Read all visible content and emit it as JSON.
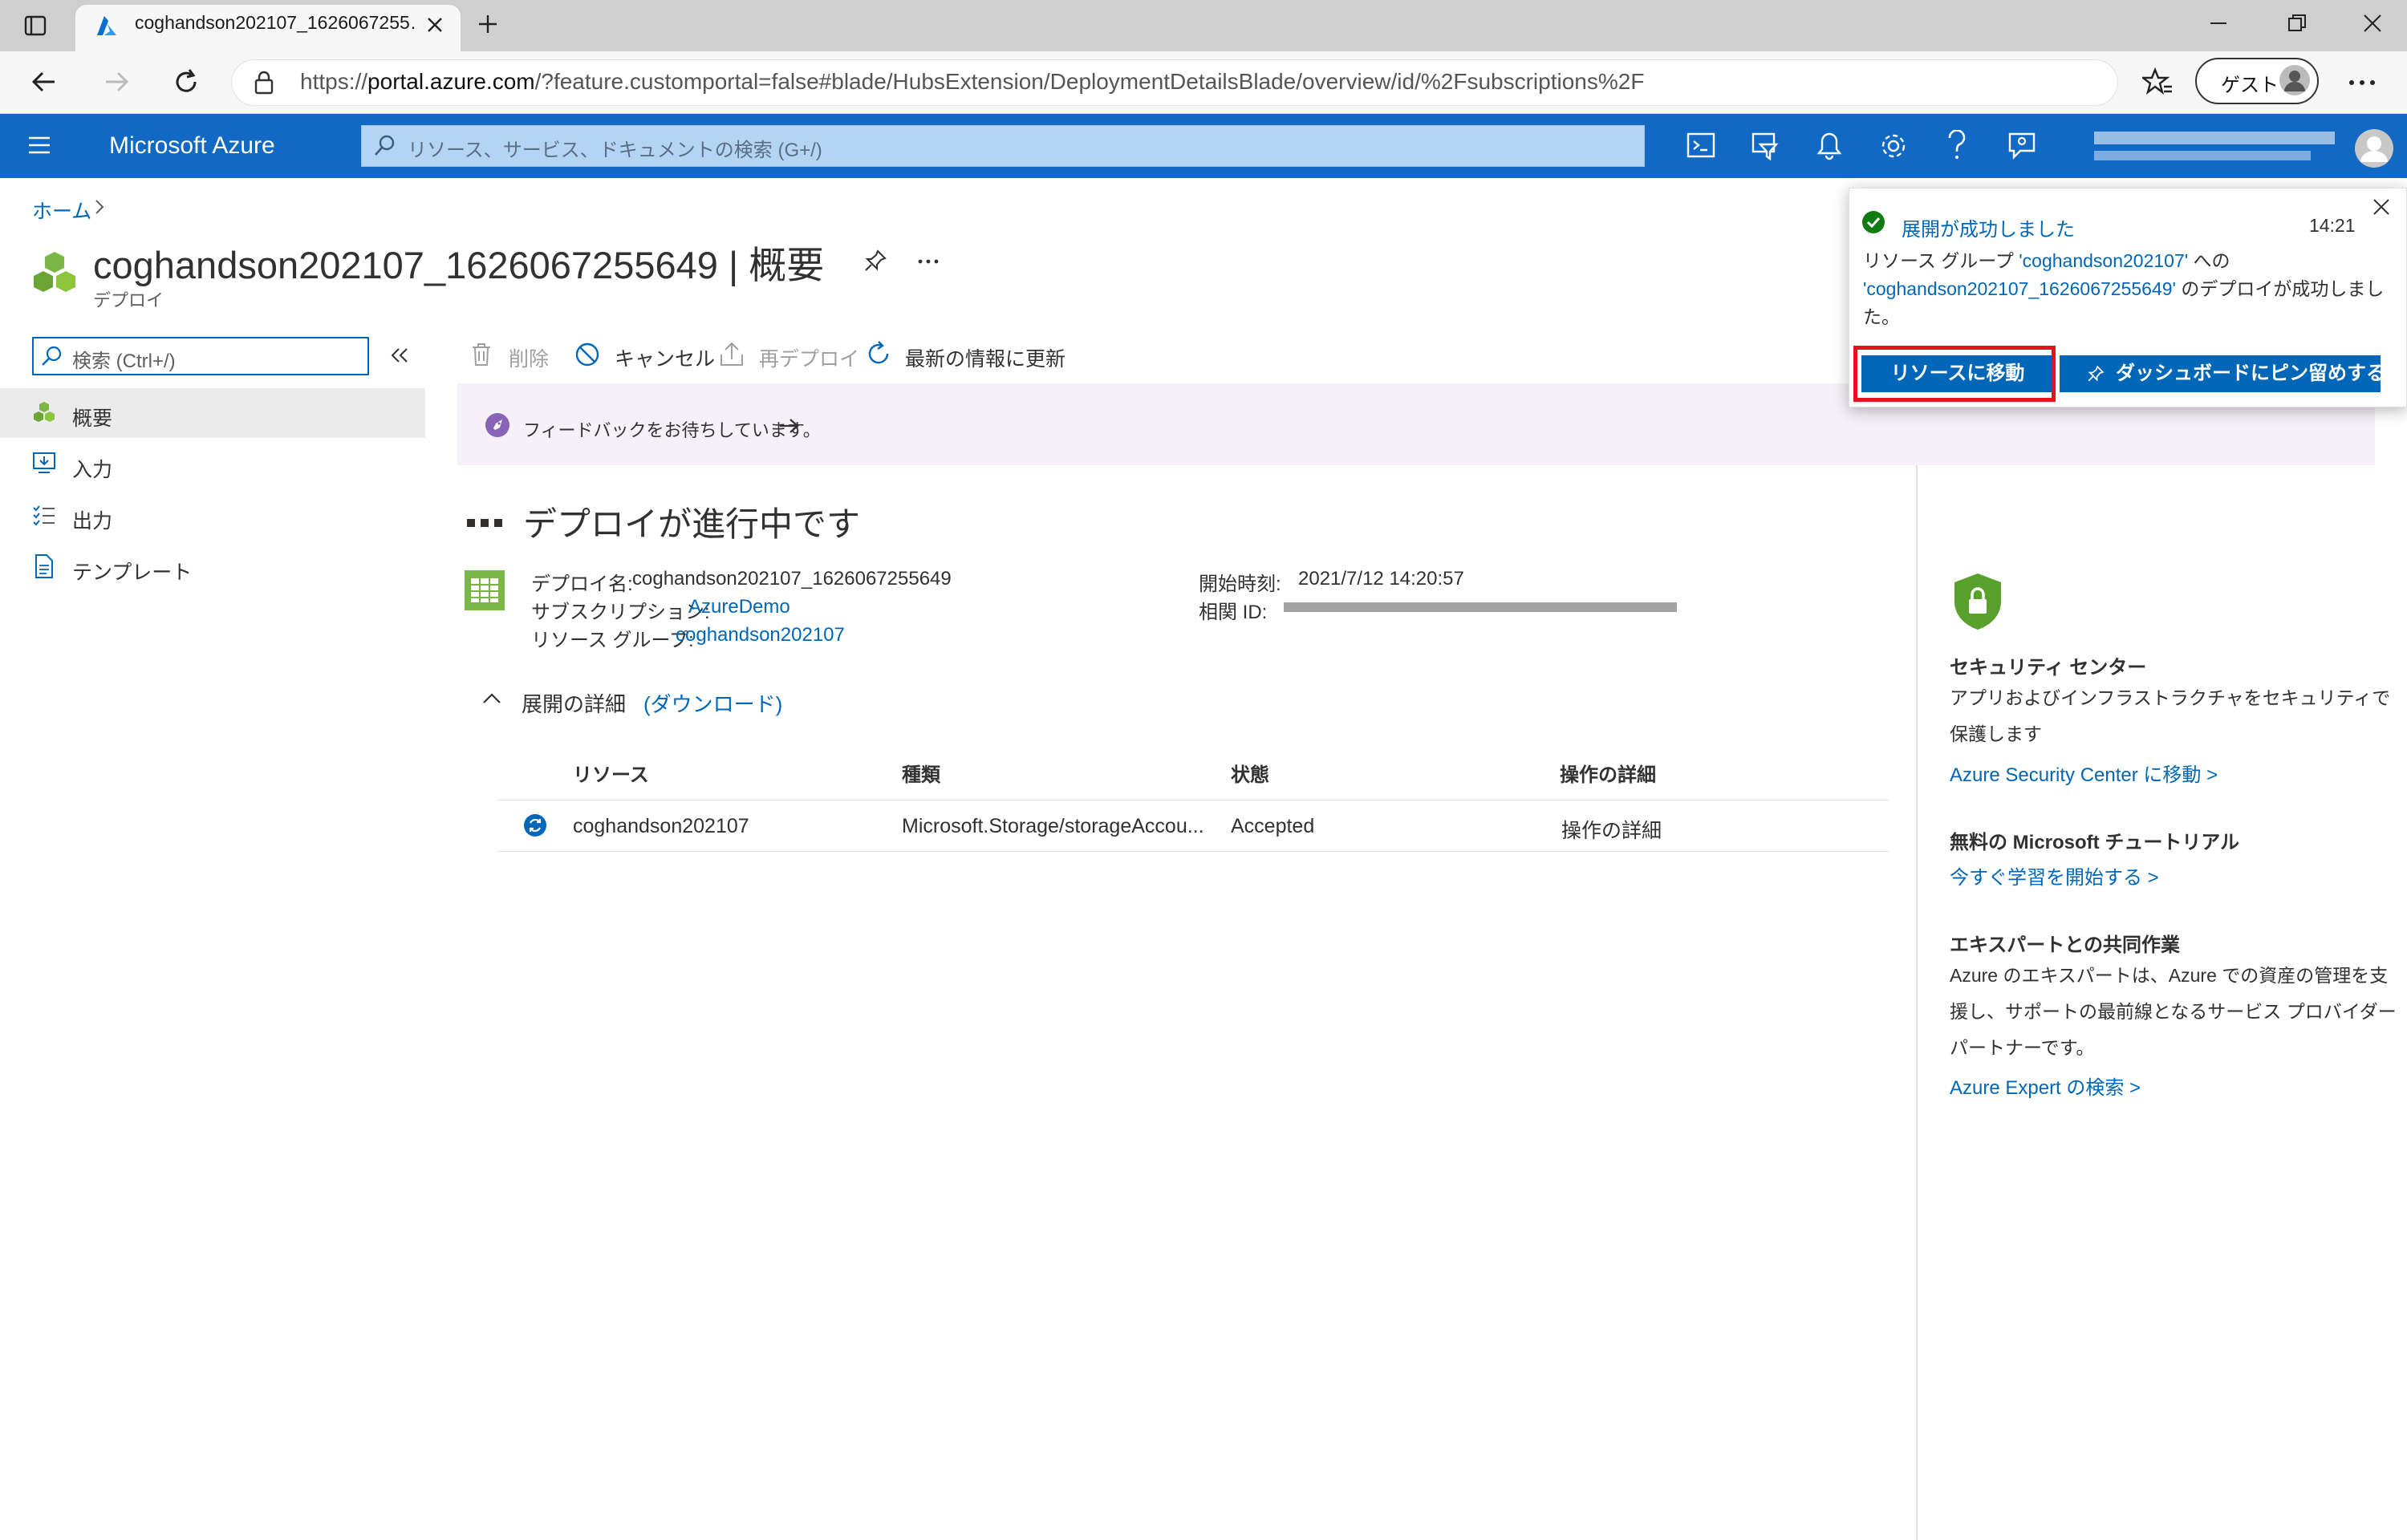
{
  "browser": {
    "tab_title": "coghandson202107_1626067255…",
    "url_prefix": "https://",
    "url_host": "portal.azure.com",
    "url_path": "/?feature.customportal=false#blade/HubsExtension/DeploymentDetailsBlade/overview/id/%2Fsubscriptions%2F",
    "guest_label": "ゲスト"
  },
  "header": {
    "brand": "Microsoft Azure",
    "search_placeholder": "リソース、サービス、ドキュメントの検索 (G+/)"
  },
  "breadcrumb": {
    "home": "ホーム"
  },
  "page": {
    "title": "coghandson202107_1626067255649 | 概要",
    "subtitle": "デプロイ"
  },
  "nav": {
    "search_placeholder": "検索 (Ctrl+/)",
    "items": [
      {
        "label": "概要",
        "active": true
      },
      {
        "label": "入力",
        "active": false
      },
      {
        "label": "出力",
        "active": false
      },
      {
        "label": "テンプレート",
        "active": false
      }
    ]
  },
  "toolbar": {
    "delete": "削除",
    "cancel": "キャンセル",
    "redeploy": "再デプロイ",
    "refresh": "最新の情報に更新"
  },
  "feedback": {
    "text": "フィードバックをお待ちしています。"
  },
  "deployment": {
    "status_title": "デプロイが進行中です",
    "name_label": "デプロイ名:",
    "name_value": "coghandson202107_1626067255649",
    "subscription_label": "サブスクリプション:",
    "subscription_value": "AzureDemo",
    "rg_label": "リソース グループ:",
    "rg_value": "coghandson202107",
    "start_label": "開始時刻:",
    "start_value": "2021/7/12 14:20:57",
    "correlation_label": "相関 ID:"
  },
  "details": {
    "heading": "展開の詳細",
    "download": "(ダウンロード)",
    "columns": [
      "リソース",
      "種類",
      "状態",
      "操作の詳細"
    ],
    "rows": [
      {
        "resource": "coghandson202107",
        "type": "Microsoft.Storage/storageAccou...",
        "status": "Accepted",
        "op_details": "操作の詳細"
      }
    ]
  },
  "right_panel": {
    "security_title": "セキュリティ センター",
    "security_text": "アプリおよびインフラストラクチャをセキュリティで保護します",
    "security_link": "Azure Security Center に移動 >",
    "tutorial_title": "無料の Microsoft チュートリアル",
    "tutorial_link": "今すぐ学習を開始する >",
    "expert_title": "エキスパートとの共同作業",
    "expert_text": "Azure のエキスパートは、Azure での資産の管理を支援し、サポートの最前線となるサービス プロバイダー パートナーです。",
    "expert_link": "Azure Expert の検索 >"
  },
  "notification": {
    "title": "展開が成功しました",
    "time": "14:21",
    "body_prefix": "リソース グループ ",
    "body_rg": "'coghandson202107'",
    "body_mid": " への ",
    "body_deploy": "'coghandson202107_1626067255649'",
    "body_suffix": " のデプロイが成功しました。",
    "go_button": "リソースに移動",
    "pin_button": "ダッシュボードにピン留めする"
  },
  "colors": {
    "azure_blue": "#1269c4",
    "link": "#0067b8",
    "highlight_red": "#e3141d",
    "success_green": "#107c10"
  }
}
